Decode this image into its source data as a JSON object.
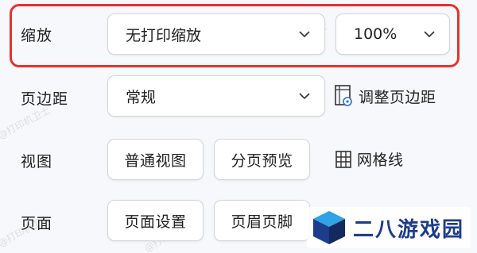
{
  "scaling": {
    "label": "缩放",
    "mode_value": "无打印缩放",
    "percent_value": "100%"
  },
  "margins": {
    "label": "页边距",
    "value": "常规",
    "adjust_label": "调整页边距"
  },
  "view": {
    "label": "视图",
    "normal_label": "普通视图",
    "page_break_label": "分页预览",
    "gridlines_label": "网格线"
  },
  "page": {
    "label": "页面",
    "setup_label": "页面设置",
    "header_footer_label": "页眉页脚"
  },
  "watermark": {
    "text": "@打印机卫士"
  },
  "logo": {
    "text": "二八游戏园"
  },
  "colors": {
    "highlight": "#e5322f",
    "logo_dark": "#1d3c8c",
    "logo_light": "#2fa3e6"
  }
}
